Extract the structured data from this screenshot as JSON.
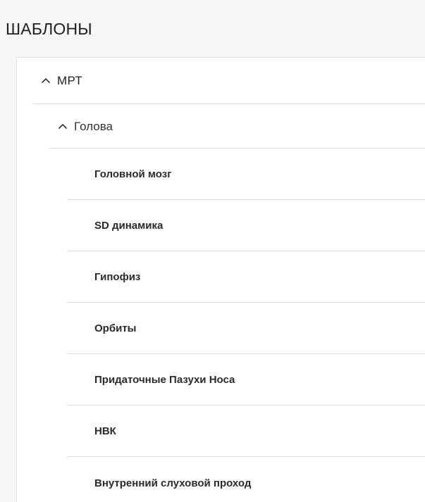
{
  "header": {
    "title": "ШАБЛОНЫ"
  },
  "tree": {
    "group": {
      "label": "МРТ",
      "expanded": true,
      "icon": "chevron-up-icon",
      "subgroup": {
        "label": "Голова",
        "expanded": true,
        "icon": "chevron-up-icon",
        "items": [
          {
            "label": "Головной мозг"
          },
          {
            "label": "SD динамика"
          },
          {
            "label": "Гипофиз"
          },
          {
            "label": "Орбиты"
          },
          {
            "label": "Придаточные Пазухи Носа"
          },
          {
            "label": "НВК"
          },
          {
            "label": "Внутренний слуховой проход"
          }
        ]
      }
    }
  }
}
